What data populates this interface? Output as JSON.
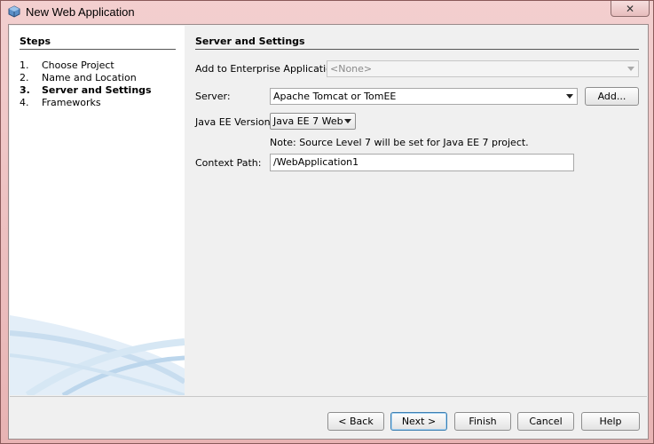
{
  "window": {
    "title": "New Web Application",
    "close_glyph": "✕"
  },
  "steps": {
    "heading": "Steps",
    "items": [
      {
        "num": "1.",
        "label": "Choose Project"
      },
      {
        "num": "2.",
        "label": "Name and Location"
      },
      {
        "num": "3.",
        "label": "Server and Settings"
      },
      {
        "num": "4.",
        "label": "Frameworks"
      }
    ],
    "current_index": 2
  },
  "panel": {
    "heading": "Server and Settings",
    "enterprise_label": "Add to Enterprise Application:",
    "enterprise_value": "<None>",
    "server_label": "Server:",
    "server_value": "Apache Tomcat or TomEE",
    "add_button": "Add...",
    "javaee_label": "Java EE Version:",
    "javaee_value": "Java EE 7 Web",
    "note": "Note: Source Level 7 will be set for Java EE 7 project.",
    "context_label": "Context Path:",
    "context_value": "/WebApplication1"
  },
  "buttons": {
    "back": "< Back",
    "next": "Next >",
    "finish": "Finish",
    "cancel": "Cancel",
    "help": "Help"
  },
  "colors": {
    "frame": "#e8b3b3",
    "panel": "#f0f0f0",
    "swoosh": "#cfe3f2"
  }
}
